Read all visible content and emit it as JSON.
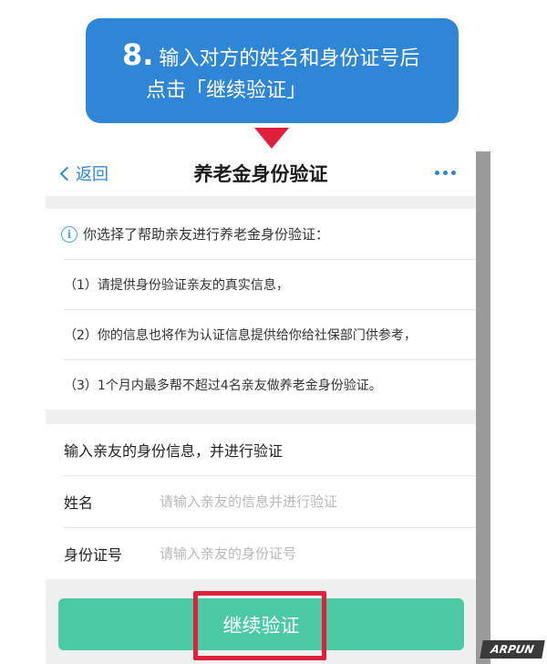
{
  "callout": {
    "step_number": "8.",
    "line1": "输入对方的姓名和身份证号后",
    "line2": "点击「继续验证」",
    "color": "#2f86d6",
    "arrow_color": "#e0203a"
  },
  "navbar": {
    "back_label": "返回",
    "title": "养老金身份验证",
    "more_icon": "more-dots-icon"
  },
  "notice": {
    "icon": "info-icon",
    "icon_glyph": "i",
    "heading": "你选择了帮助亲友进行养老金身份验证：",
    "items": [
      "（1）请提供身份验证亲友的真实信息，",
      "（2）你的信息也将作为认证信息提供给你给社保部门供参考，",
      "（3）1个月内最多帮不超过4名亲友做养老金身份验证。"
    ]
  },
  "form": {
    "heading": "输入亲友的身份信息，并进行验证",
    "fields": [
      {
        "label": "姓名",
        "value": "",
        "placeholder": "请输入亲友的信息并进行验证"
      },
      {
        "label": "身份证号",
        "value": "",
        "placeholder": "请输入亲友的身份证号"
      }
    ]
  },
  "submit": {
    "label": "继续验证",
    "color": "#4ccaa6",
    "highlight_color": "#e0203a"
  },
  "watermark": "ARPUN"
}
